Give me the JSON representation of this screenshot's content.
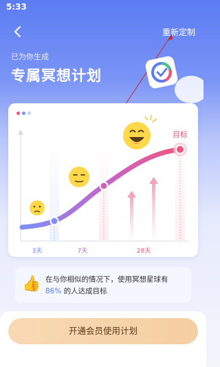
{
  "status_bar": {
    "time": "5:33"
  },
  "header": {
    "redo_label": "重新定制",
    "subtitle": "已为你生成",
    "title": "专属冥想计划"
  },
  "chart_data": {
    "type": "line",
    "x": [
      "3天",
      "7天",
      "28天"
    ],
    "goal_label": "目标",
    "colors": {
      "start": "#7b8ff7",
      "end": "#f0557a"
    }
  },
  "tip": {
    "prefix": "在与你相似的情况下，使用冥想星球有",
    "highlight": "86%",
    "suffix": "的人达成目标"
  },
  "cta": {
    "label": "开通会员使用计划"
  },
  "icons": {
    "back": "chevron-left-icon",
    "app": "app-check-icon",
    "thumb": "thumbs-up-icon"
  }
}
